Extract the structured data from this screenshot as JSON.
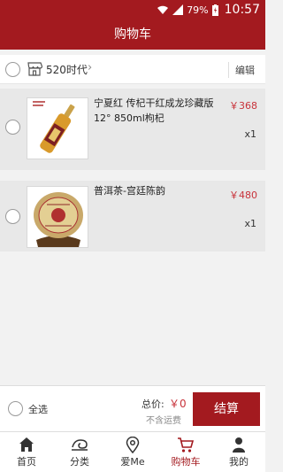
{
  "status_bar": {
    "battery": "79%",
    "time": "10:57"
  },
  "header": {
    "title": "购物车"
  },
  "store": {
    "name": "520时代",
    "edit_label": "编辑"
  },
  "cart_items": [
    {
      "title": "宁夏红 传杞干红成龙珍藏版12° 850ml枸杞",
      "price": "￥368",
      "qty": "x1"
    },
    {
      "title": "普洱茶-宫廷陈韵",
      "price": "￥480",
      "qty": "x1"
    }
  ],
  "footer": {
    "select_all": "全选",
    "total_label": "总价:",
    "total_value": "￥0",
    "shipping_note": "不含运费",
    "checkout_label": "结算"
  },
  "tabs": [
    {
      "label": "首页",
      "icon": "home-icon"
    },
    {
      "label": "分类",
      "icon": "category-icon"
    },
    {
      "label": "爱Me",
      "icon": "location-pin-icon"
    },
    {
      "label": "购物车",
      "icon": "cart-icon",
      "active": true
    },
    {
      "label": "我的",
      "icon": "user-icon"
    }
  ],
  "colors": {
    "brand_red": "#a31a1f",
    "price_red": "#c8323a"
  }
}
